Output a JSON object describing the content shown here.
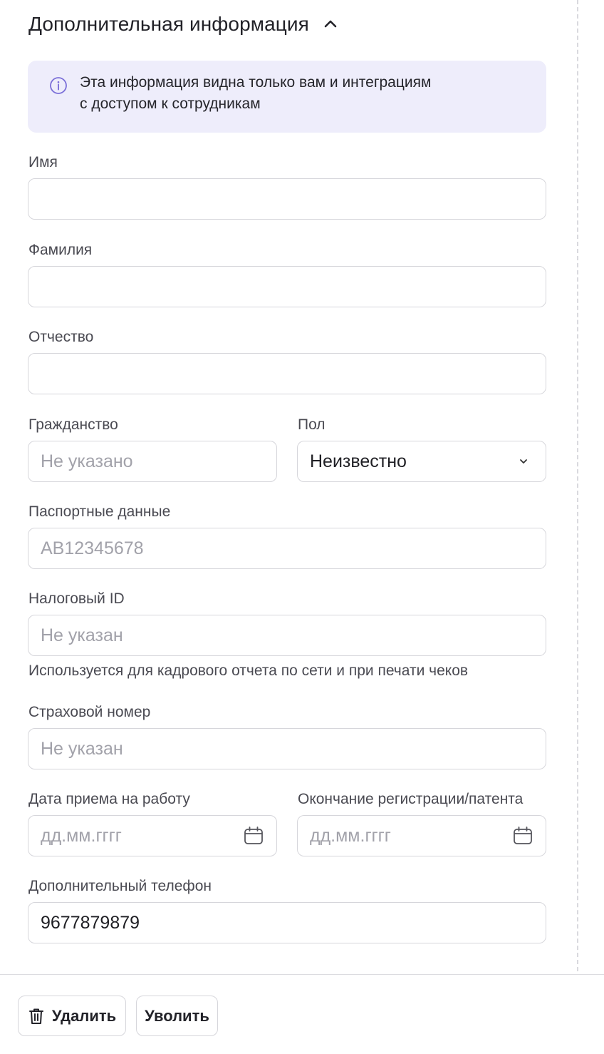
{
  "section": {
    "title": "Дополнительная информация",
    "toggle_icon": "chevron-up-icon"
  },
  "info": {
    "icon": "info-icon",
    "line1": "Эта информация видна только вам и интеграциям",
    "line2": "с доступом к сотрудникам"
  },
  "fields": {
    "first_name": {
      "label": "Имя",
      "value": ""
    },
    "last_name": {
      "label": "Фамилия",
      "value": ""
    },
    "patronymic": {
      "label": "Отчество",
      "value": ""
    },
    "citizenship": {
      "label": "Гражданство",
      "placeholder": "Не указано"
    },
    "gender": {
      "label": "Пол",
      "value": "Неизвестно",
      "icon": "chevron-down-icon"
    },
    "passport": {
      "label": "Паспортные данные",
      "placeholder": "AB12345678"
    },
    "tax_id": {
      "label": "Налоговый ID",
      "placeholder": "Не указан",
      "hint": "Используется для кадрового отчета по сети и при печати чеков"
    },
    "insurance": {
      "label": "Страховой номер",
      "placeholder": "Не указан"
    },
    "hire_date": {
      "label": "Дата приема на работу",
      "placeholder": "дд.мм.гггг",
      "icon": "calendar-icon"
    },
    "registration_end": {
      "label": "Окончание регистрации/патента",
      "placeholder": "дд.мм.гггг",
      "icon": "calendar-icon"
    },
    "extra_phone": {
      "label": "Дополнительный телефон",
      "value": "9677879879"
    }
  },
  "actions": {
    "delete_label": "Удалить",
    "delete_icon": "trash-icon",
    "dismiss_label": "Уволить"
  },
  "colors": {
    "info_bg": "#eeedfb",
    "info_icon": "#7b6fd8",
    "border": "#d6d6db",
    "placeholder": "#a2a2aa"
  }
}
